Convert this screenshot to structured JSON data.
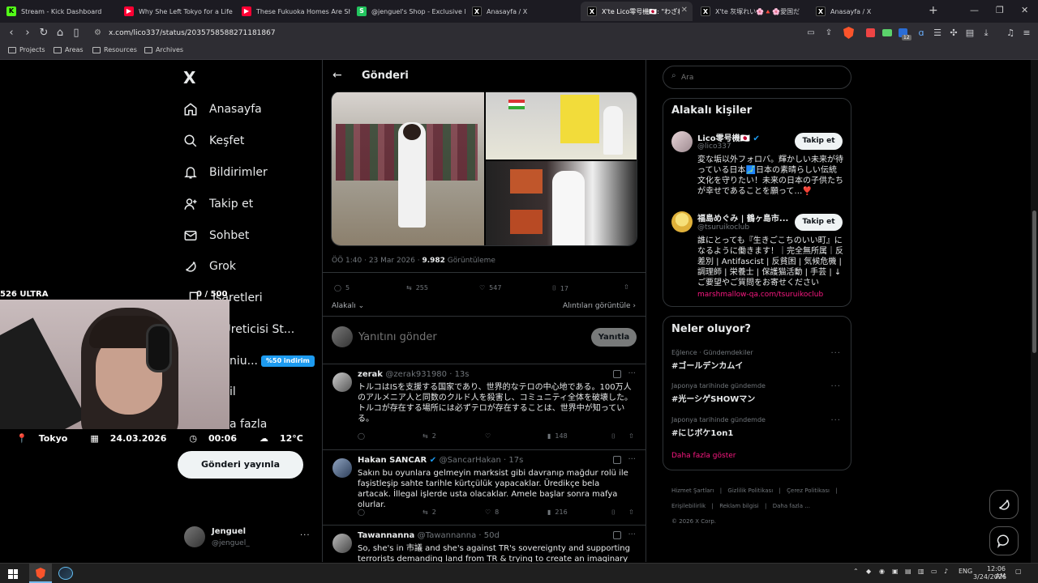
{
  "browser": {
    "tabs": [
      {
        "title": "Stream - Kick Dashboard",
        "icon": "kick-icon",
        "color": "#53fc18"
      },
      {
        "title": "Why She Left Tokyo for a Life i",
        "icon": "youtube-icon",
        "color": "#ff0033"
      },
      {
        "title": "These Fukuoka Homes Are Sho",
        "icon": "youtube-icon",
        "color": "#ff0033"
      },
      {
        "title": "@jenguel's Shop - Exclusive M",
        "icon": "shop-icon",
        "color": "#22c55e"
      },
      {
        "title": "Anasayfa / X",
        "icon": "x-icon",
        "color": "#000"
      },
      {
        "title": "X'te Lico零号機🇯🇵: \"わざわざ",
        "icon": "x-icon",
        "color": "#000"
      },
      {
        "title": "X'te 灰塚れい🌸🔺🌸愛国だも",
        "icon": "x-icon",
        "color": "#000"
      },
      {
        "title": "Anasayfa / X",
        "icon": "x-icon",
        "color": "#000"
      }
    ],
    "url": "x.com/lico337/status/2035758588271181867",
    "bookmarks": [
      "Projects",
      "Areas",
      "Resources",
      "Archives"
    ],
    "extension_badge": "12"
  },
  "sidebar": {
    "logo": "X",
    "items": [
      {
        "label": "Anasayfa",
        "icon": "home-icon"
      },
      {
        "label": "Keşfet",
        "icon": "search-icon"
      },
      {
        "label": "Bildirimler",
        "icon": "bell-icon"
      },
      {
        "label": "Takip et",
        "icon": "add-person-icon"
      },
      {
        "label": "Sohbet",
        "icon": "mail-icon"
      },
      {
        "label": "Grok",
        "icon": "grok-icon"
      },
      {
        "label": "İşaretleri",
        "icon": "bookmark-icon"
      },
      {
        "label": "k Üreticisi St...",
        "icon": "creator-icon"
      },
      {
        "label": "niu...",
        "icon": "premium-icon"
      },
      {
        "label": "il",
        "icon": "profile-icon"
      },
      {
        "label": "a fazla",
        "icon": "more-icon"
      }
    ],
    "discount_badge": "%50 indirim",
    "post_button": "Gönderi yayınla",
    "account": {
      "name": "Jenguel",
      "handle": "@jenguel_"
    }
  },
  "webcam_overlay": {
    "top_left": "526 ULTRA",
    "top_right": "0 / 500",
    "city": "Tokyo",
    "date": "24.03.2026",
    "time": "00:06",
    "temp": "12°C"
  },
  "main": {
    "header_title": "Gönderi",
    "post_meta": {
      "time": "ÖÖ 1:40 · 23 Mar 2026 · ",
      "views": "9.982",
      "views_label": " Görüntüleme"
    },
    "post_actions": {
      "replies": "5",
      "reposts": "255",
      "likes": "547",
      "bookmarks": "17"
    },
    "sort_label": "Alakalı",
    "quotes_link": "Alıntıları görüntüle",
    "reply_placeholder": "Yanıtını gönder",
    "reply_button": "Yanıtla",
    "replies": [
      {
        "name": "zerak",
        "handle": "@zerak931980 · 13s",
        "text": "トルコはISを支援する国家であり、世界的なテロの中心地である。100万人のアルメニア人と同数のクルド人を殺害し、コミュニティ全体を破壊した。トルコが存在する場所には必ずテロが存在することは、世界中が知っている。",
        "replies": "",
        "reposts": "2",
        "likes": "",
        "views": "148"
      },
      {
        "name": "Hakan SANCAR",
        "verified": true,
        "handle": "@SancarHakan · 17s",
        "text": "Sakın bu oyunlara gelmeyin marksist gibi davranıp mağdur rolü ile faşistleşip sahte tarihle kürtçülük yapacaklar. Üredikçe bela artacak. İllegal işlerde usta olacaklar. Amele başlar sonra mafya olurlar.",
        "replies": "",
        "reposts": "2",
        "likes": "8",
        "views": "216"
      },
      {
        "name": "Tawannanna",
        "handle": "@Tawannanna · 50d",
        "text": "So, she's in 市議 and she's against TR's sovereignty and supporting terrorists demanding land from TR & trying to create an imaginary country (the map is",
        "replies": "",
        "reposts": "",
        "likes": "",
        "views": ""
      }
    ]
  },
  "right": {
    "search_placeholder": "Ara",
    "related_title": "Alakalı kişiler",
    "people": [
      {
        "name": "Lico零号機🇯🇵",
        "verified": true,
        "handle": "@lico337",
        "bio": "変な垢以外フォロバ。輝かしい未来が待っている日本🗾日本の素晴らしい伝統文化を守りたい！未来の日本の子供たちが幸せであることを願って…❣️",
        "button": "Takip et"
      },
      {
        "name": "福島めぐみ | 鶴ヶ島市...",
        "handle": "@tsuruikoclub",
        "bio": "誰にとっても『生きごこちのいい町』になるように働きます！｜完全無所属｜反差別 | Antifascist | 反貧困 | 気候危機 | 調理師 | 栄養士 | 保護猫活動 | 手芸 | ↓ご要望やご質問をお寄せください",
        "link": "marshmallow-qa.com/tsuruikoclub",
        "button": "Takip et"
      }
    ],
    "trends_title": "Neler oluyor?",
    "trends": [
      {
        "category": "Eğlence · Gündemdekiler",
        "name": "#ゴールデンカムイ"
      },
      {
        "category": "Japonya tarihinde gündemde",
        "name": "#光ーシゲSHOWマン"
      },
      {
        "category": "Japonya tarihinde gündemde",
        "name": "#にじボケ1on1"
      }
    ],
    "show_more": "Daha fazla göster",
    "footer": [
      "Hizmet Şartları",
      "Gizlilik Politikası",
      "Çerez Politikası",
      "Erişilebilirlik",
      "Reklam bilgisi",
      "Daha fazla ...",
      "© 2026 X Corp."
    ]
  },
  "taskbar": {
    "lang": "ENG",
    "time": "12:06 AM",
    "date": "3/24/2026"
  }
}
